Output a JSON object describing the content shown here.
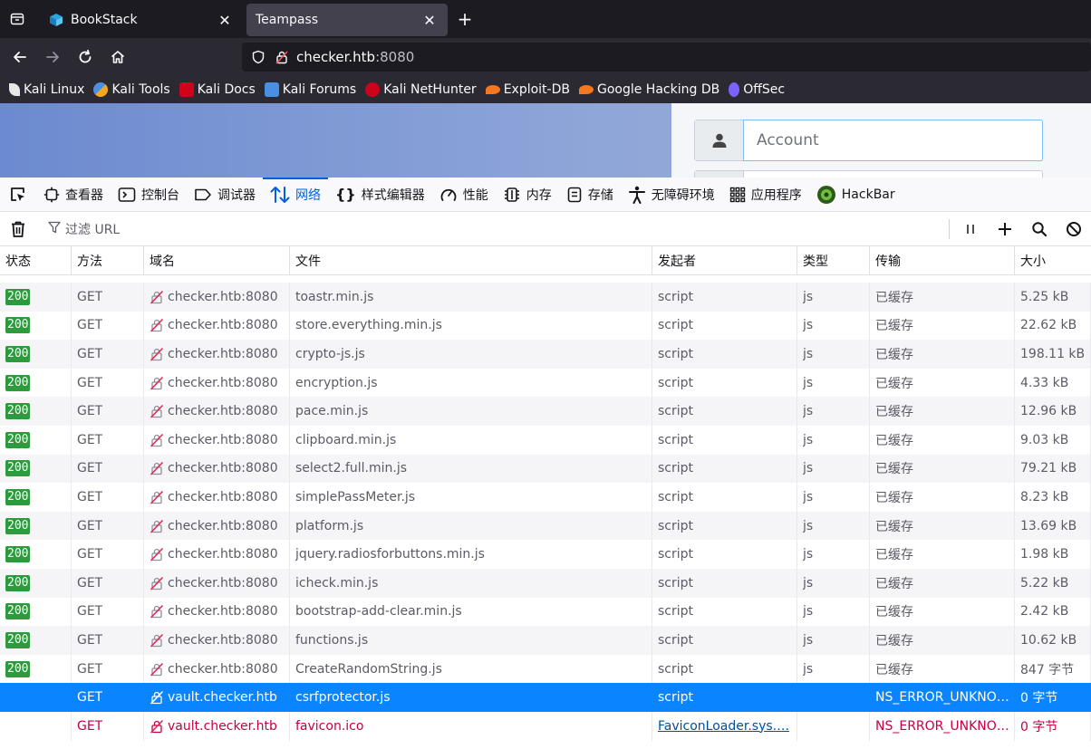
{
  "browser": {
    "tabs": [
      {
        "label": "BookStack",
        "active": false
      },
      {
        "label": "Teampass",
        "active": true
      }
    ],
    "url": {
      "host": "checker.htb",
      "port": ":8080"
    },
    "bookmarks": [
      {
        "label": "Kali Linux",
        "icon": "kali-dragon-icon",
        "color": "#e8e8e8"
      },
      {
        "label": "Kali Tools",
        "icon": "kali-tools-icon",
        "color": "#f5a623"
      },
      {
        "label": "Kali Docs",
        "icon": "kali-docs-icon",
        "color": "#d0021b"
      },
      {
        "label": "Kali Forums",
        "icon": "kali-forums-icon",
        "color": "#4a90e2"
      },
      {
        "label": "Kali NetHunter",
        "icon": "nethunter-icon",
        "color": "#d0021b"
      },
      {
        "label": "Exploit-DB",
        "icon": "exploit-db-icon",
        "color": "#f5781e"
      },
      {
        "label": "Google Hacking DB",
        "icon": "ghdb-icon",
        "color": "#f5781e"
      },
      {
        "label": "OffSec",
        "icon": "offsec-icon",
        "color": "#7b61ff"
      }
    ]
  },
  "page": {
    "account_placeholder": "Account"
  },
  "devtools": {
    "tabs": [
      {
        "label": "查看器",
        "icon": "inspector-icon"
      },
      {
        "label": "控制台",
        "icon": "console-icon"
      },
      {
        "label": "调试器",
        "icon": "debugger-icon"
      },
      {
        "label": "网络",
        "icon": "network-icon",
        "active": true
      },
      {
        "label": "样式编辑器",
        "icon": "style-editor-icon"
      },
      {
        "label": "性能",
        "icon": "performance-icon"
      },
      {
        "label": "内存",
        "icon": "memory-icon"
      },
      {
        "label": "存储",
        "icon": "storage-icon"
      },
      {
        "label": "无障碍环境",
        "icon": "accessibility-icon"
      },
      {
        "label": "应用程序",
        "icon": "application-icon"
      },
      {
        "label": "HackBar",
        "icon": "hackbar-icon"
      }
    ],
    "filter_placeholder": "过滤 URL",
    "columns": [
      "状态",
      "方法",
      "域名",
      "文件",
      "发起者",
      "类型",
      "传输",
      "大小"
    ],
    "rows": [
      {
        "status": "200",
        "method": "GET",
        "domain": "checker.htb:8080",
        "file": "toastr.min.js",
        "initiator": "script",
        "type": "js",
        "transfer": "已缓存",
        "size": "5.25 kB"
      },
      {
        "status": "200",
        "method": "GET",
        "domain": "checker.htb:8080",
        "file": "store.everything.min.js",
        "initiator": "script",
        "type": "js",
        "transfer": "已缓存",
        "size": "22.62 kB"
      },
      {
        "status": "200",
        "method": "GET",
        "domain": "checker.htb:8080",
        "file": "crypto-js.js",
        "initiator": "script",
        "type": "js",
        "transfer": "已缓存",
        "size": "198.11 kB"
      },
      {
        "status": "200",
        "method": "GET",
        "domain": "checker.htb:8080",
        "file": "encryption.js",
        "initiator": "script",
        "type": "js",
        "transfer": "已缓存",
        "size": "4.33 kB"
      },
      {
        "status": "200",
        "method": "GET",
        "domain": "checker.htb:8080",
        "file": "pace.min.js",
        "initiator": "script",
        "type": "js",
        "transfer": "已缓存",
        "size": "12.96 kB"
      },
      {
        "status": "200",
        "method": "GET",
        "domain": "checker.htb:8080",
        "file": "clipboard.min.js",
        "initiator": "script",
        "type": "js",
        "transfer": "已缓存",
        "size": "9.03 kB"
      },
      {
        "status": "200",
        "method": "GET",
        "domain": "checker.htb:8080",
        "file": "select2.full.min.js",
        "initiator": "script",
        "type": "js",
        "transfer": "已缓存",
        "size": "79.21 kB"
      },
      {
        "status": "200",
        "method": "GET",
        "domain": "checker.htb:8080",
        "file": "simplePassMeter.js",
        "initiator": "script",
        "type": "js",
        "transfer": "已缓存",
        "size": "8.23 kB"
      },
      {
        "status": "200",
        "method": "GET",
        "domain": "checker.htb:8080",
        "file": "platform.js",
        "initiator": "script",
        "type": "js",
        "transfer": "已缓存",
        "size": "13.69 kB"
      },
      {
        "status": "200",
        "method": "GET",
        "domain": "checker.htb:8080",
        "file": "jquery.radiosforbuttons.min.js",
        "initiator": "script",
        "type": "js",
        "transfer": "已缓存",
        "size": "1.98 kB"
      },
      {
        "status": "200",
        "method": "GET",
        "domain": "checker.htb:8080",
        "file": "icheck.min.js",
        "initiator": "script",
        "type": "js",
        "transfer": "已缓存",
        "size": "5.22 kB"
      },
      {
        "status": "200",
        "method": "GET",
        "domain": "checker.htb:8080",
        "file": "bootstrap-add-clear.min.js",
        "initiator": "script",
        "type": "js",
        "transfer": "已缓存",
        "size": "2.42 kB"
      },
      {
        "status": "200",
        "method": "GET",
        "domain": "checker.htb:8080",
        "file": "functions.js",
        "initiator": "script",
        "type": "js",
        "transfer": "已缓存",
        "size": "10.62 kB"
      },
      {
        "status": "200",
        "method": "GET",
        "domain": "checker.htb:8080",
        "file": "CreateRandomString.js",
        "initiator": "script",
        "type": "js",
        "transfer": "已缓存",
        "size": "847 字节"
      },
      {
        "status": "",
        "method": "GET",
        "domain": "vault.checker.htb",
        "file": "csrfprotector.js",
        "initiator": "script",
        "type": "",
        "transfer": "NS_ERROR_UNKNO…",
        "size": "0 字节",
        "state": "selected"
      },
      {
        "status": "",
        "method": "GET",
        "domain": "vault.checker.htb",
        "file": "favicon.ico",
        "initiator": "FaviconLoader.sys.…",
        "type": "",
        "transfer": "NS_ERROR_UNKNO…",
        "size": "0 字节",
        "state": "error"
      }
    ]
  }
}
